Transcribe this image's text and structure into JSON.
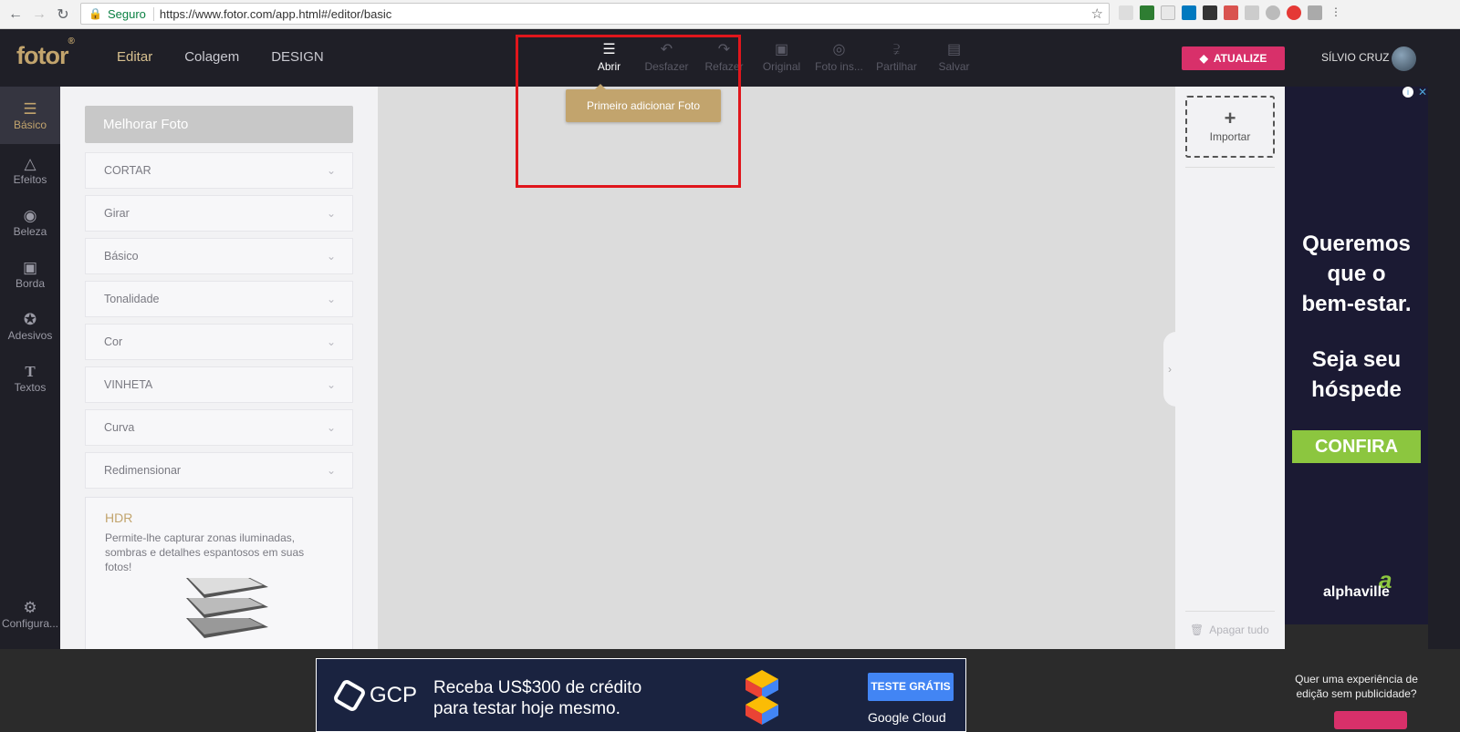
{
  "browser": {
    "secure_label": "Seguro",
    "url": "https://www.fotor.com/app.html#/editor/basic"
  },
  "app": {
    "logo": "fotor",
    "logo_mark": "®",
    "nav": [
      "Editar",
      "Colagem",
      "DESIGN"
    ],
    "toolbar": [
      {
        "label": "Abrir",
        "icon": "menu-icon"
      },
      {
        "label": "Desfazer",
        "icon": "undo-icon"
      },
      {
        "label": "Refazer",
        "icon": "redo-icon"
      },
      {
        "label": "Original",
        "icon": "image-icon"
      },
      {
        "label": "Foto ins...",
        "icon": "focus-icon"
      },
      {
        "label": "Partilhar",
        "icon": "share-icon"
      },
      {
        "label": "Salvar",
        "icon": "save-icon"
      }
    ],
    "upgrade_label": "ATUALIZE",
    "username": "SÍLVIO CRUZ"
  },
  "sidebar": {
    "items": [
      {
        "label": "Básico",
        "icon": "sliders-icon"
      },
      {
        "label": "Efeitos",
        "icon": "flask-icon"
      },
      {
        "label": "Beleza",
        "icon": "eye-icon"
      },
      {
        "label": "Borda",
        "icon": "frame-icon"
      },
      {
        "label": "Adesivos",
        "icon": "star-icon"
      },
      {
        "label": "Textos",
        "icon": "text-icon"
      }
    ],
    "settings_label": "Configura..."
  },
  "panel": {
    "enhance_button": "Melhorar Foto",
    "sections": [
      "CORTAR",
      "Girar",
      "Básico",
      "Tonalidade",
      "Cor",
      "VINHETA",
      "Curva",
      "Redimensionar"
    ],
    "hdr_title": "HDR",
    "hdr_desc": "Permite-lhe capturar zonas iluminadas, sombras e detalhes espantosos em suas fotos!"
  },
  "canvas": {
    "tooltip": "Primeiro adicionar Foto"
  },
  "right_panel": {
    "import_label": "Importar",
    "clear_label": "Apagar tudo"
  },
  "ad_right": {
    "line1": "Queremos",
    "line2": "que o",
    "line3": "bem-estar.",
    "line4": "Seja seu",
    "line5": "hóspede",
    "cta": "CONFIRA",
    "brand": "alphaville"
  },
  "ad_bottom": {
    "brand": "GCP",
    "line1": "Receba US$300 de crédito",
    "line2": "para testar hoje mesmo.",
    "button": "TESTE GRÁTIS",
    "sub": "Google Cloud"
  },
  "no_ads": {
    "text1": "Quer uma experiência de",
    "text2": "edição sem publicidade?"
  },
  "colors": {
    "accent_gold": "#c2a46d",
    "upgrade_pink": "#d8306a",
    "highlight_red": "#e0161c"
  }
}
